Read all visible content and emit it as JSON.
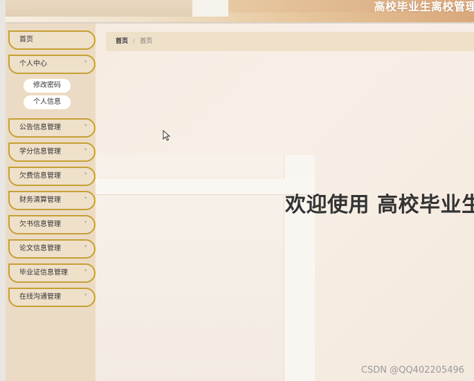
{
  "header": {
    "title": "高校毕业生离校管理"
  },
  "sidebar": {
    "items": [
      {
        "label": "首页"
      },
      {
        "label": "个人中心",
        "expanded": true,
        "children": [
          {
            "label": "修改密码"
          },
          {
            "label": "个人信息"
          }
        ]
      },
      {
        "label": "公告信息管理"
      },
      {
        "label": "学分信息管理"
      },
      {
        "label": "欠费信息管理"
      },
      {
        "label": "财务清算管理"
      },
      {
        "label": "欠书信息管理"
      },
      {
        "label": "论文信息管理"
      },
      {
        "label": "毕业证信息管理"
      },
      {
        "label": "在线沟通管理"
      }
    ],
    "chevron": "˅"
  },
  "breadcrumb": {
    "home": "首页",
    "separator": "/",
    "current": "首页"
  },
  "main": {
    "welcome_text": "欢迎使用 高校毕业生"
  },
  "watermark": "CSDN @QQ402205496",
  "colors": {
    "menu_border": "#c4a035",
    "sidebar_bg": "#ecdbc4",
    "breadcrumb_bg": "#efe0c9"
  },
  "icons": {
    "chevron": "chevron-down-icon",
    "cursor": "mouse-pointer-icon"
  }
}
